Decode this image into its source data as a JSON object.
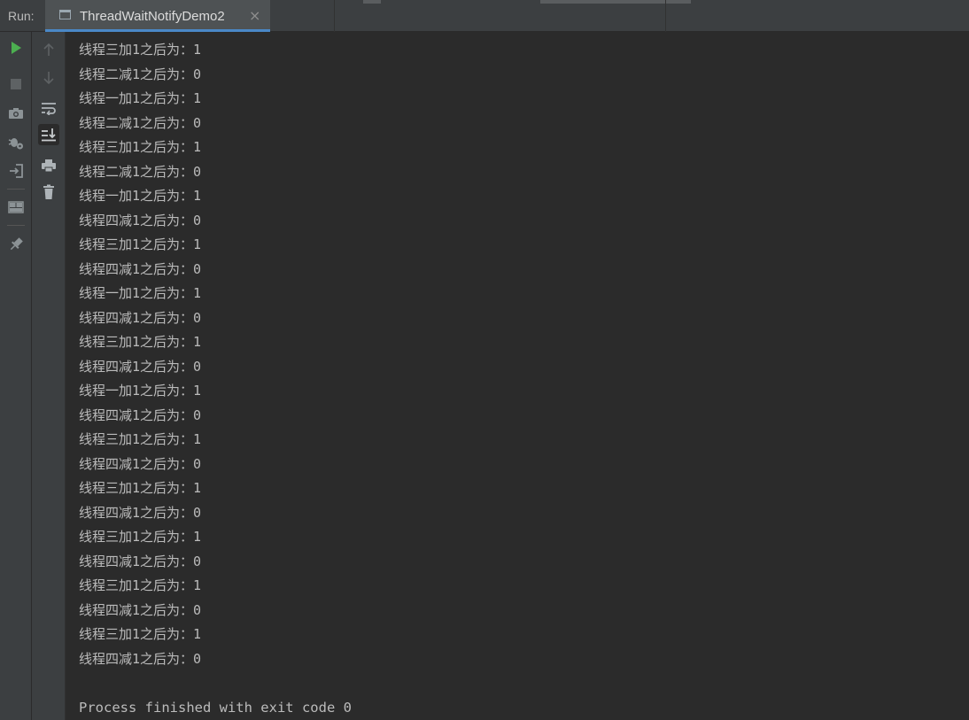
{
  "tool_window": {
    "label": "Run:",
    "tab_title": "ThreadWaitNotifyDemo2",
    "tab_close": "×",
    "accent_color": "#4a88c7",
    "run_color": "#4caf50"
  },
  "toolbar_left": [
    {
      "name": "rerun",
      "icon": "play-icon"
    },
    {
      "name": "stop",
      "icon": "stop-icon"
    },
    {
      "name": "dump-threads",
      "icon": "camera-icon"
    },
    {
      "name": "exit",
      "icon": "exit-icon"
    },
    {
      "name": "layout",
      "icon": "layout-icon"
    },
    {
      "name": "pin-tab",
      "icon": "pin-icon"
    }
  ],
  "toolbar_right": [
    {
      "name": "previous-occurrence",
      "icon": "arrow-up-icon"
    },
    {
      "name": "next-occurrence",
      "icon": "arrow-down-icon"
    },
    {
      "name": "soft-wrap",
      "icon": "soft-wrap-icon"
    },
    {
      "name": "scroll-to-end",
      "icon": "scroll-to-end-icon"
    },
    {
      "name": "print",
      "icon": "print-icon"
    },
    {
      "name": "clear-all",
      "icon": "trash-icon"
    }
  ],
  "console": {
    "lines": [
      "线程三加1之后为：1",
      "线程二减1之后为：0",
      "线程一加1之后为：1",
      "线程二减1之后为：0",
      "线程三加1之后为：1",
      "线程二减1之后为：0",
      "线程一加1之后为：1",
      "线程四减1之后为：0",
      "线程三加1之后为：1",
      "线程四减1之后为：0",
      "线程一加1之后为：1",
      "线程四减1之后为：0",
      "线程三加1之后为：1",
      "线程四减1之后为：0",
      "线程一加1之后为：1",
      "线程四减1之后为：0",
      "线程三加1之后为：1",
      "线程四减1之后为：0",
      "线程三加1之后为：1",
      "线程四减1之后为：0",
      "线程三加1之后为：1",
      "线程四减1之后为：0",
      "线程三加1之后为：1",
      "线程四减1之后为：0",
      "线程三加1之后为：1",
      "线程四减1之后为：0"
    ],
    "exit_message": "Process finished with exit code 0"
  }
}
